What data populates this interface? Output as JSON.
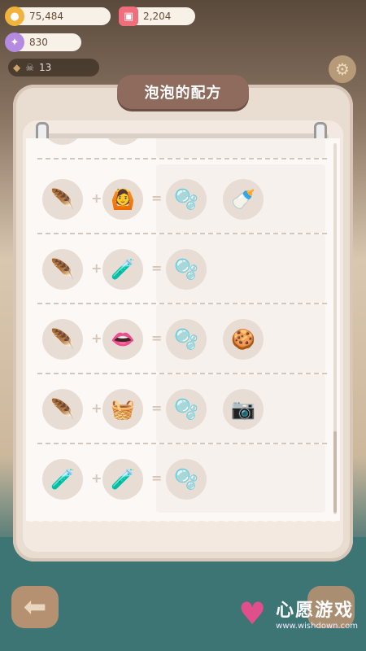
{
  "hud": {
    "coins": "75,484",
    "gems": "2,204",
    "candy": "830",
    "status_count": "13"
  },
  "panel": {
    "title": "泡泡的配方"
  },
  "icons": {
    "coin": "coin-icon",
    "gem": "ticket-icon",
    "candy": "candy-icon",
    "skull": "skull-icon",
    "gear": "gear-icon",
    "back": "arrow-left-icon"
  },
  "recipes": [
    {
      "a": "🪶",
      "b": "🙆",
      "results": [
        "🫧",
        "🍼"
      ]
    },
    {
      "a": "🪶",
      "b": "🧪",
      "results": [
        "🫧"
      ]
    },
    {
      "a": "🪶",
      "b": "👄",
      "results": [
        "🫧",
        "🍪"
      ]
    },
    {
      "a": "🪶",
      "b": "🧺",
      "results": [
        "🫧",
        "📷"
      ]
    },
    {
      "a": "🧪",
      "b": "🧪",
      "results": [
        "🫧"
      ]
    }
  ],
  "operators": {
    "plus": "+",
    "equals": "="
  },
  "watermark": {
    "brand": "心愿游戏",
    "url": "www.wishdown.com",
    "tag": "wish"
  }
}
